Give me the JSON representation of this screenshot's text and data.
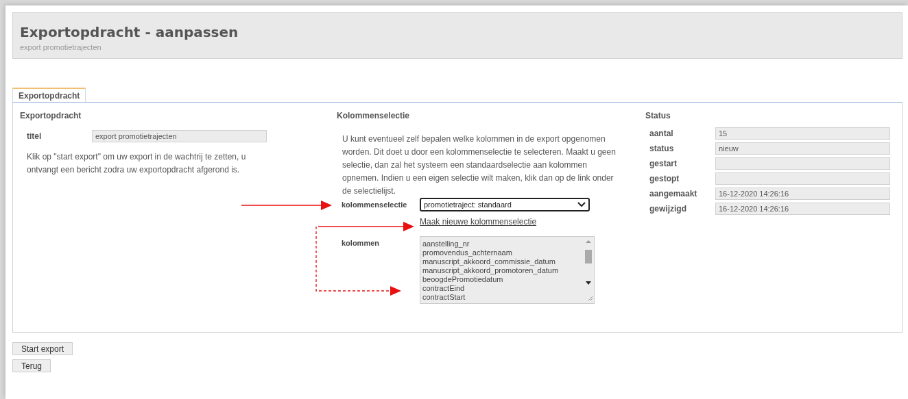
{
  "header": {
    "title": "Exportopdracht - aanpassen",
    "subtitle": "export promotietrajecten"
  },
  "tabs": [
    {
      "label": "Exportopdracht",
      "selected": true
    }
  ],
  "export_section": {
    "heading": "Exportopdracht",
    "fields": [
      {
        "label": "titel",
        "value": "export promotietrajecten"
      }
    ],
    "instructions": "Klik op \"start export\" om uw export in de wachtrij te zetten, u ontvangt een bericht zodra uw exportopdracht afgerond is."
  },
  "column_section": {
    "heading": "Kolommenselectie",
    "instructions": "U kunt eventueel zelf bepalen welke kolommen in de export opgenomen worden. Dit doet u door een kolommenselectie te selecteren. Maakt u geen selectie, dan zal het systeem een standaardselectie aan kolommen opnemen. Indien u een eigen selectie wilt maken, klik dan op de link onder de selectielijst.",
    "selection_label": "kolommenselectie",
    "selection_value": "promotietraject: standaard",
    "new_selection_link": "Maak nieuwe kolommenselectie",
    "columns_label": "kolommen",
    "columns": [
      "aanstelling_nr",
      "promovendus_achternaam",
      "manuscript_akkoord_commissie_datum",
      "manuscript_akkoord_promotoren_datum",
      "beoogdePromotiedatum",
      "contractEind",
      "contractStart"
    ]
  },
  "status_section": {
    "heading": "Status",
    "fields": [
      {
        "label": "aantal",
        "value": "15"
      },
      {
        "label": "status",
        "value": "nieuw"
      },
      {
        "label": "gestart"
      },
      {
        "label": "gestopt"
      },
      {
        "label": "aangemaakt",
        "value": "16-12-2020 14:26:16"
      },
      {
        "label": "gewijzigd",
        "value": "16-12-2020 14:26:16"
      }
    ]
  },
  "buttons": [
    "Start export",
    "Terug"
  ]
}
